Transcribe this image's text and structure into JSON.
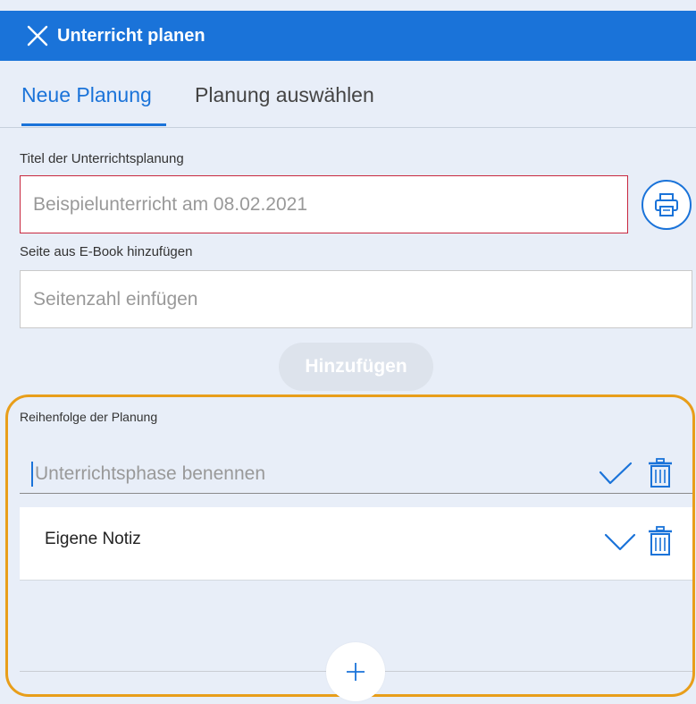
{
  "header": {
    "title": "Unterricht planen",
    "close_icon": "close-icon",
    "background": "#1a73d9"
  },
  "tabs": [
    {
      "label": "Neue Planung",
      "active": true
    },
    {
      "label": "Planung auswählen",
      "active": false
    }
  ],
  "form": {
    "title_label": "Titel der Unterrichtsplanung",
    "title_placeholder": "Beispielunterricht am 08.02.2021",
    "print_icon": "printer-icon",
    "page_label": "Seite aus E-Book hinzufügen",
    "page_placeholder": "Seitenzahl einfügen",
    "add_button": "Hinzufügen"
  },
  "order": {
    "label": "Reihenfolge der Planung",
    "phase_placeholder": "Unterrichtsphase benennen",
    "items": [
      {
        "label": "Eigene Notiz"
      }
    ],
    "highlight_color": "#e89e1a"
  }
}
